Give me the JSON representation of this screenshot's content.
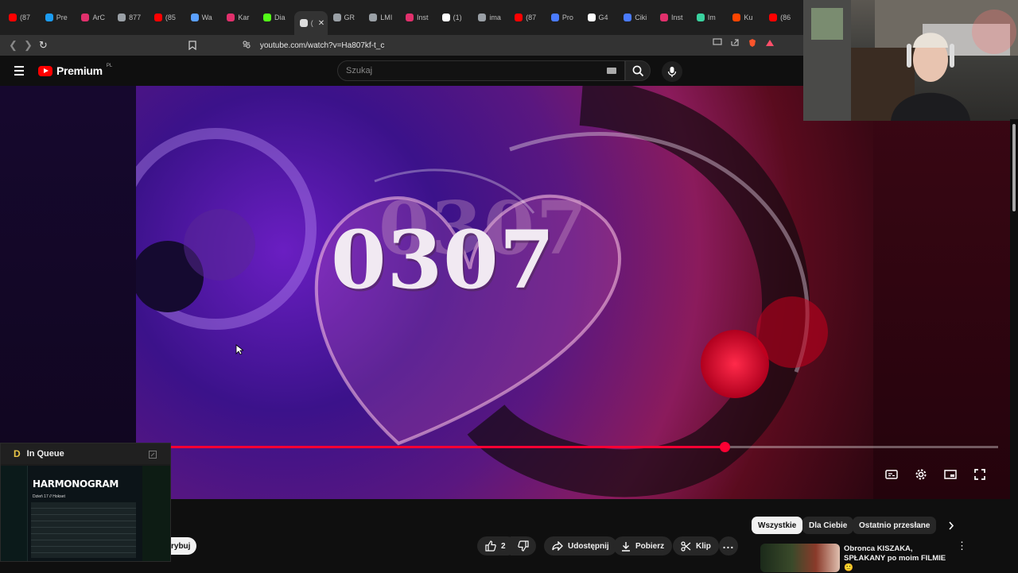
{
  "browser": {
    "tabs": [
      {
        "label": "(87",
        "color": "#ff0000"
      },
      {
        "label": "Pre",
        "color": "#1b9cf2"
      },
      {
        "label": "ArC",
        "color": "#e1306c"
      },
      {
        "label": "877",
        "color": "#9aa0a6"
      },
      {
        "label": "(85",
        "color": "#ff0000"
      },
      {
        "label": "Wa",
        "color": "#5aa0ff"
      },
      {
        "label": "Kar",
        "color": "#e1306c"
      },
      {
        "label": "Dia",
        "color": "#53fc18"
      },
      {
        "label": "(",
        "color": "#dddddd",
        "active": true
      },
      {
        "label": "GR",
        "color": "#9aa0a6"
      },
      {
        "label": "LMI",
        "color": "#9aa0a6"
      },
      {
        "label": "Inst",
        "color": "#e1306c"
      },
      {
        "label": "(1)",
        "color": "#ffffff"
      },
      {
        "label": "ima",
        "color": "#9aa0a6"
      },
      {
        "label": "(87",
        "color": "#ff0000"
      },
      {
        "label": "Pro",
        "color": "#4a7bff"
      },
      {
        "label": "G4",
        "color": "#ffffff"
      },
      {
        "label": "Ciki",
        "color": "#4a7bff"
      },
      {
        "label": "Inst",
        "color": "#e1306c"
      },
      {
        "label": "Im",
        "color": "#3ad29f"
      },
      {
        "label": "Ku",
        "color": "#ff4500"
      },
      {
        "label": "(86",
        "color": "#ff0000"
      }
    ],
    "url": "youtube.com/watch?v=Ha807kf-t_c",
    "active_tab_close": "✕"
  },
  "youtube": {
    "logo_text": "Premium",
    "logo_region": "PL",
    "search_placeholder": "Szukaj",
    "brand_color": "#ff0000"
  },
  "player": {
    "progress_fraction": 0.669,
    "video_text": "0307",
    "progress_color": "#ff0033"
  },
  "below": {
    "chips": [
      "Wszystkie",
      "Dla Ciebie",
      "Ostatnio przesłane"
    ],
    "actions": {
      "like_count": "2",
      "share": "Udostępnij",
      "download": "Pobierz",
      "clip": "Klip"
    },
    "subscribe_partial": "rybuj",
    "recommended_title": "Obronca KISZAKA, SPŁAKANY po moim FILMIE 🙂"
  },
  "pip": {
    "title": "In Queue",
    "thumb_title": "HARMONOGRAM",
    "thumb_subtitle": "Dzień 17 // Hokset"
  }
}
